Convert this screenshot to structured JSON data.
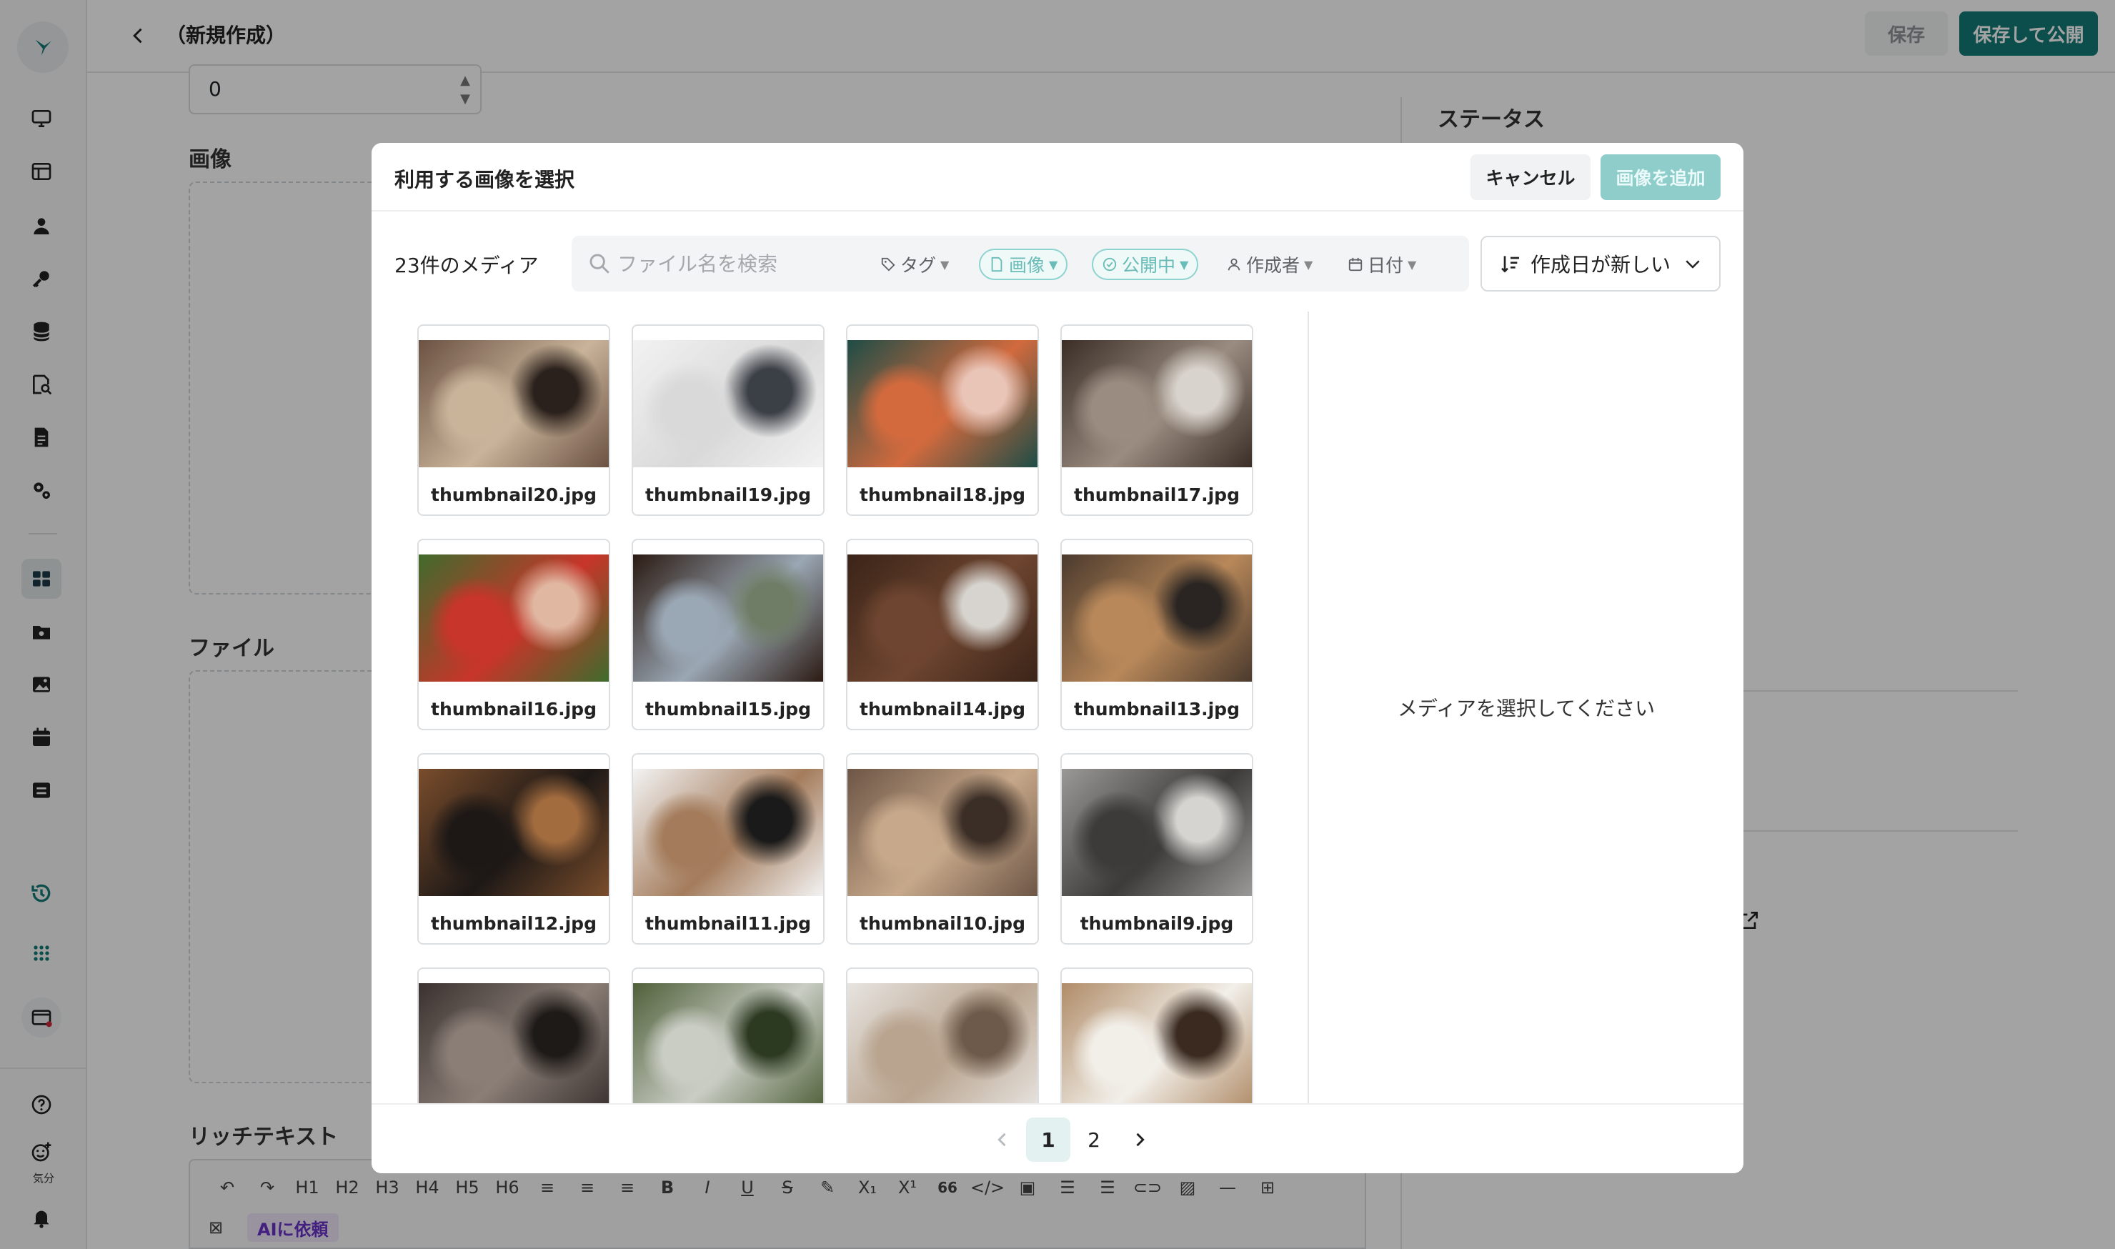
{
  "header": {
    "title": "（新規作成）",
    "save_label": "保存",
    "publish_label": "保存して公開"
  },
  "sidebar": {
    "mood_label": "気分"
  },
  "form": {
    "number_value": "0",
    "image_label": "画像",
    "file_label": "ファイル",
    "richtext_label": "リッチテキスト",
    "toolbar": [
      "H1",
      "H2",
      "H3",
      "H4",
      "H5",
      "H6"
    ],
    "bold": "B",
    "italic": "I",
    "underline": "U",
    "strike": "S",
    "sub": "X₁",
    "sup": "X¹",
    "quote": "66",
    "code": "</>",
    "ai_label": "AIに依頼"
  },
  "right_panel": {
    "status_title": "ステータス"
  },
  "modal": {
    "title": "利用する画像を選択",
    "cancel_label": "キャンセル",
    "add_label": "画像を追加",
    "media_count": "23件のメディア",
    "search_placeholder": "ファイル名を検索",
    "filters": {
      "tag": "タグ",
      "image": "画像",
      "published": "公開中",
      "author": "作成者",
      "date": "日付"
    },
    "sort_label": "作成日が新しい",
    "empty_preview": "メディアを選択してください",
    "thumbnails": [
      {
        "name": "thumbnail20.jpg",
        "colors": [
          "#6b5243",
          "#c9b49a",
          "#2b211c"
        ]
      },
      {
        "name": "thumbnail19.jpg",
        "colors": [
          "#f2f2f2",
          "#d9d9d9",
          "#3b3f46"
        ]
      },
      {
        "name": "thumbnail18.jpg",
        "colors": [
          "#1e4c46",
          "#d26a3e",
          "#e9c5b8"
        ]
      },
      {
        "name": "thumbnail17.jpg",
        "colors": [
          "#3a2e27",
          "#9a8c80",
          "#d8d3cc"
        ]
      },
      {
        "name": "thumbnail16.jpg",
        "colors": [
          "#3f6b2c",
          "#c8352a",
          "#e0b7a1"
        ]
      },
      {
        "name": "thumbnail15.jpg",
        "colors": [
          "#2b1a12",
          "#9aa7b4",
          "#6f7d66"
        ]
      },
      {
        "name": "thumbnail14.jpg",
        "colors": [
          "#3a2418",
          "#6e4530",
          "#d7d4cf"
        ]
      },
      {
        "name": "thumbnail13.jpg",
        "colors": [
          "#4b3a2d",
          "#b8885a",
          "#2a2522"
        ]
      },
      {
        "name": "thumbnail12.jpg",
        "colors": [
          "#7a4d2c",
          "#1d1816",
          "#a36c3f"
        ]
      },
      {
        "name": "thumbnail11.jpg",
        "colors": [
          "#f3f3f3",
          "#a47c5c",
          "#1a1a1a"
        ]
      },
      {
        "name": "thumbnail10.jpg",
        "colors": [
          "#6d5646",
          "#c7a88a",
          "#3b2e26"
        ]
      },
      {
        "name": "thumbnail9.jpg",
        "colors": [
          "#9a9997",
          "#3d3b3a",
          "#d6d4d0"
        ]
      },
      {
        "name": "",
        "colors": [
          "#3b3230",
          "#8a7e76",
          "#1e1a18"
        ]
      },
      {
        "name": "",
        "colors": [
          "#50603a",
          "#c9cdc4",
          "#2d3a22"
        ]
      },
      {
        "name": "",
        "colors": [
          "#e7e4e0",
          "#b9a48f",
          "#6d5a4a"
        ]
      },
      {
        "name": "",
        "colors": [
          "#b08c68",
          "#f2efe9",
          "#3a2a1f"
        ]
      }
    ],
    "pagination": {
      "current": "1",
      "next_page": "2"
    }
  }
}
